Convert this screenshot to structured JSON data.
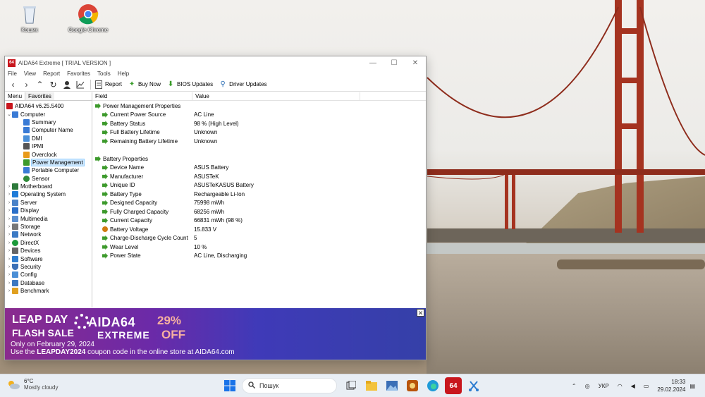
{
  "desktop": {
    "icons": [
      {
        "label": "Кошик"
      },
      {
        "label": "Google Chrome"
      }
    ]
  },
  "window": {
    "title": "AIDA64 Extreme  [ TRIAL VERSION ]",
    "app_icon_text": "64",
    "controls": {
      "minimize": "—",
      "maximize": "☐",
      "close": "✕"
    },
    "menu": [
      "File",
      "View",
      "Report",
      "Favorites",
      "Tools",
      "Help"
    ],
    "toolbar": {
      "report": "Report",
      "buy_now": "Buy Now",
      "bios_updates": "BIOS Updates",
      "driver_updates": "Driver Updates"
    },
    "left_tabs": {
      "menu": "Menu",
      "favorites": "Favorites"
    },
    "tree": {
      "root": "AIDA64 v6.25.5400",
      "computer": "Computer",
      "computer_children": [
        "Summary",
        "Computer Name",
        "DMI",
        "IPMI",
        "Overclock",
        "Power Management",
        "Portable Computer",
        "Sensor"
      ],
      "top_nodes": [
        "Motherboard",
        "Operating System",
        "Server",
        "Display",
        "Multimedia",
        "Storage",
        "Network",
        "DirectX",
        "Devices",
        "Software",
        "Security",
        "Config",
        "Database",
        "Benchmark"
      ]
    },
    "columns": {
      "field": "Field",
      "value": "Value"
    },
    "sections": [
      {
        "title": "Power Management Properties",
        "rows": [
          {
            "field": "Current Power Source",
            "value": "AC Line"
          },
          {
            "field": "Battery Status",
            "value": "98 % (High Level)"
          },
          {
            "field": "Full Battery Lifetime",
            "value": "Unknown"
          },
          {
            "field": "Remaining Battery Lifetime",
            "value": "Unknown"
          }
        ]
      },
      {
        "title": "Battery Properties",
        "rows": [
          {
            "field": "Device Name",
            "value": "ASUS Battery"
          },
          {
            "field": "Manufacturer",
            "value": "ASUSTeK"
          },
          {
            "field": "Unique ID",
            "value": "ASUSTeKASUS Battery"
          },
          {
            "field": "Battery Type",
            "value": "Rechargeable Li-Ion"
          },
          {
            "field": "Designed Capacity",
            "value": "75998 mWh"
          },
          {
            "field": "Fully Charged Capacity",
            "value": "68256 mWh"
          },
          {
            "field": "Current Capacity",
            "value": "66831 mWh  (98 %)"
          },
          {
            "field": "Battery Voltage",
            "value": "15.833 V"
          },
          {
            "field": "Charge-Discharge Cycle Count",
            "value": "5"
          },
          {
            "field": "Wear Level",
            "value": "10 %"
          },
          {
            "field": "Power State",
            "value": "AC Line, Discharging"
          }
        ]
      }
    ],
    "ad": {
      "leap": "LEAP DAY",
      "flash": "FLASH SALE",
      "brand": "AIDA64",
      "edition": "EXTREME",
      "discount": "29%",
      "off": "OFF",
      "date": "Only on February 29, 2024",
      "coupon_prefix": "Use the ",
      "coupon_code": "LEAPDAY2024",
      "coupon_suffix": " coupon code in the online store at AIDA64.com",
      "close": "✕"
    }
  },
  "taskbar": {
    "weather_temp": "6°C",
    "weather_desc": "Mostly cloudy",
    "search_placeholder": "Пошук",
    "language": "УКР",
    "time": "18:33",
    "date": "29.02.2024"
  },
  "colors": {
    "aida_red": "#c8161d",
    "selection": "#cde8ff",
    "green_icon": "#3d9a2c",
    "taskbar_bg": "#e9eef4"
  }
}
